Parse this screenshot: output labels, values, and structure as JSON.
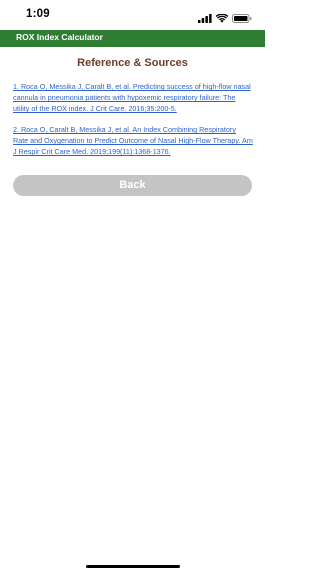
{
  "status_bar": {
    "time": "1:09",
    "icons": [
      "signal-icon",
      "wifi-icon",
      "battery-icon"
    ]
  },
  "header": {
    "title": "ROX Index Calculator",
    "background_color": "#2f7d33"
  },
  "page": {
    "title": "Reference & Sources",
    "title_color": "#6b3d2a"
  },
  "references": [
    {
      "text": "1. Roca O, Messika J, Caralt B, et al. Predicting success of high-flow nasal cannula in pneumonia patients with hypoxemic respiratory failure: The utility of the ROX index. J Crit Care. 2016;35:200-5."
    },
    {
      "text": "2. Roca O, Caralt B, Messika J, et al. An Index Combining Respiratory Rate and Oxygenation to Predict Outcome of Nasal High-Flow Therapy. Am J Respir Crit Care Med. 2019;199(11):1368-1376."
    }
  ],
  "link_color": "#2d63c9",
  "back_button": {
    "label": "Back",
    "color": "#c4c4c4"
  }
}
